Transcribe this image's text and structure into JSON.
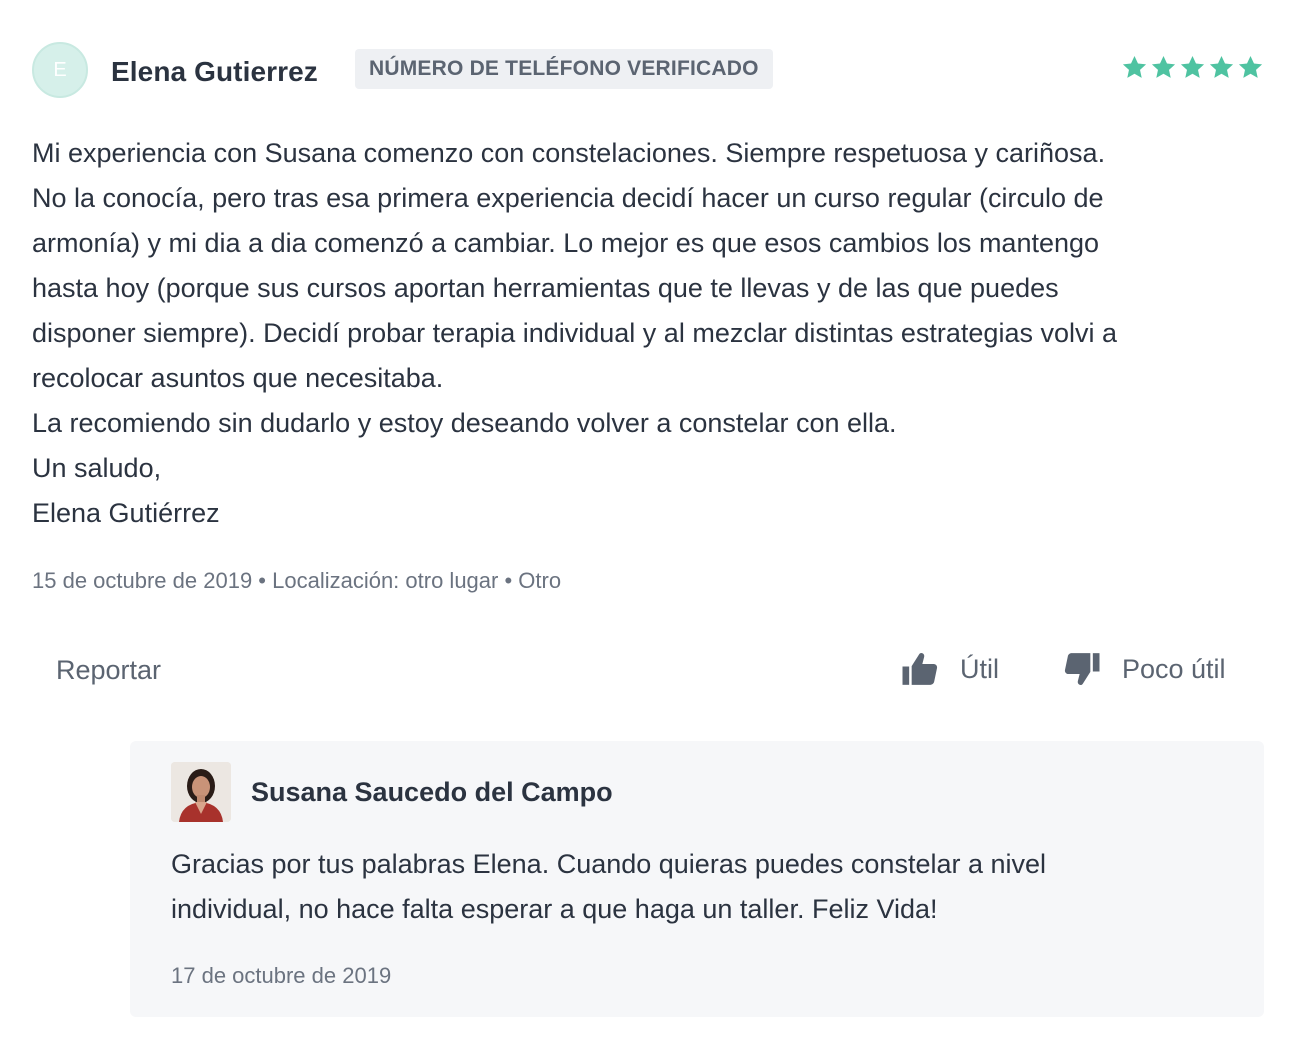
{
  "review": {
    "avatar_letter": "E",
    "author": "Elena Gutierrez",
    "badge": "NÚMERO DE TELÉFONO VERIFICADO",
    "rating": 5,
    "star_color": "#4fc3a1",
    "lines": [
      "Mi experiencia con Susana comenzo con constelaciones. Siempre respetuosa y cariñosa.",
      "No la conocía, pero tras esa primera experiencia decidí hacer un curso regular (circulo de",
      "armonía) y mi dia a dia comenzó a cambiar. Lo mejor es que esos cambios los mantengo",
      "hasta hoy (porque sus cursos aportan herramientas que te llevas y de las que puedes",
      "disponer siempre). Decidí probar terapia individual y al mezclar distintas estrategias volvi a",
      "recolocar asuntos que necesitaba.",
      "La recomiendo sin dudarlo y estoy deseando volver a constelar con ella.",
      "Un saludo,",
      "Elena Gutiérrez"
    ],
    "meta": "15 de octubre de 2019 • Localización: otro lugar • Otro"
  },
  "actions": {
    "report": "Reportar",
    "useful": "Útil",
    "not_useful": "Poco útil"
  },
  "reply": {
    "author": "Susana Saucedo del Campo",
    "lines": [
      "Gracias por tus palabras Elena. Cuando quieras puedes constelar a nivel",
      "individual, no hace falta esperar a que haga un taller. Feliz Vida!"
    ],
    "date": "17 de octubre de 2019"
  }
}
